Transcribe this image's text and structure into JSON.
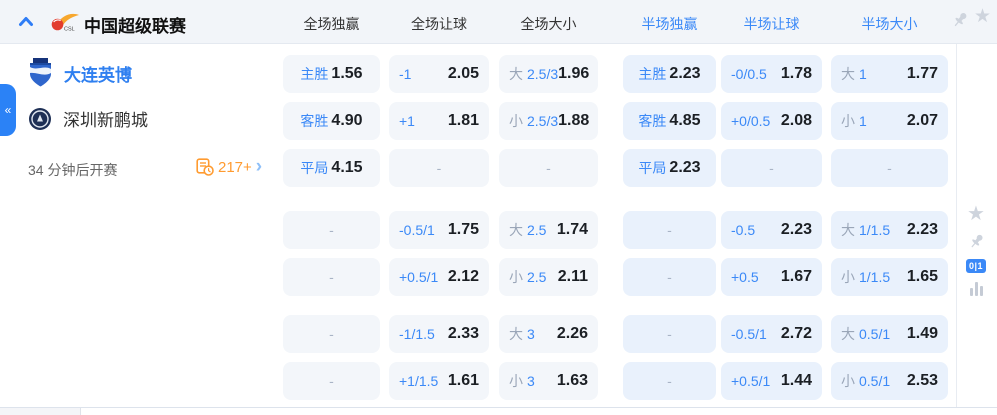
{
  "header": {
    "league_title": "中国超级联赛",
    "columns": [
      {
        "label": "全场独赢",
        "scope": "full"
      },
      {
        "label": "全场让球",
        "scope": "full"
      },
      {
        "label": "全场大小",
        "scope": "full"
      },
      {
        "label": "半场独赢",
        "scope": "half"
      },
      {
        "label": "半场让球",
        "scope": "half"
      },
      {
        "label": "半场大小",
        "scope": "half"
      }
    ]
  },
  "match": {
    "home_team": "大连英博",
    "away_team": "深圳新鹏城",
    "kickoff_note": "34 分钟后开赛",
    "markets_count": "217+",
    "markets_chevron": "›",
    "collapse_tab_glyph": "«"
  },
  "odds": {
    "rows": [
      {
        "cells": [
          {
            "label": "主胜",
            "value": "1.56"
          },
          {
            "label": "-1",
            "value": "2.05"
          },
          {
            "prefix": "大",
            "label": "2.5/3",
            "value": "1.96"
          },
          {
            "label": "主胜",
            "value": "2.23"
          },
          {
            "label": "-0/0.5",
            "value": "1.78"
          },
          {
            "prefix": "大",
            "label": "1",
            "value": "1.77"
          }
        ]
      },
      {
        "cells": [
          {
            "label": "客胜",
            "value": "4.90"
          },
          {
            "label": "+1",
            "value": "1.81"
          },
          {
            "prefix": "小",
            "label": "2.5/3",
            "value": "1.88"
          },
          {
            "label": "客胜",
            "value": "4.85"
          },
          {
            "label": "+0/0.5",
            "value": "2.08"
          },
          {
            "prefix": "小",
            "label": "1",
            "value": "2.07"
          }
        ]
      },
      {
        "cells": [
          {
            "label": "平局",
            "value": "4.15"
          },
          {
            "dash": "-"
          },
          {
            "dash": "-"
          },
          {
            "label": "平局",
            "value": "2.23"
          },
          {
            "dash": "-"
          },
          {
            "dash": "-"
          }
        ]
      },
      {
        "cells": [
          {
            "dash": "-"
          },
          {
            "label": "-0.5/1",
            "value": "1.75"
          },
          {
            "prefix": "大",
            "label": "2.5",
            "value": "1.74"
          },
          {
            "dash": "-"
          },
          {
            "label": "-0.5",
            "value": "2.23"
          },
          {
            "prefix": "大",
            "label": "1/1.5",
            "value": "2.23"
          }
        ]
      },
      {
        "cells": [
          {
            "dash": "-"
          },
          {
            "label": "+0.5/1",
            "value": "2.12"
          },
          {
            "prefix": "小",
            "label": "2.5",
            "value": "2.11"
          },
          {
            "dash": "-"
          },
          {
            "label": "+0.5",
            "value": "1.67"
          },
          {
            "prefix": "小",
            "label": "1/1.5",
            "value": "1.65"
          }
        ]
      },
      {
        "cells": [
          {
            "dash": "-"
          },
          {
            "label": "-1/1.5",
            "value": "2.33"
          },
          {
            "prefix": "大",
            "label": "3",
            "value": "2.26"
          },
          {
            "dash": "-"
          },
          {
            "label": "-0.5/1",
            "value": "2.72"
          },
          {
            "prefix": "大",
            "label": "0.5/1",
            "value": "1.49"
          }
        ]
      },
      {
        "cells": [
          {
            "dash": "-"
          },
          {
            "label": "+1/1.5",
            "value": "1.61"
          },
          {
            "prefix": "小",
            "label": "3",
            "value": "1.63"
          },
          {
            "dash": "-"
          },
          {
            "label": "+0.5/1",
            "value": "1.44"
          },
          {
            "prefix": "小",
            "label": "0.5/1",
            "value": "2.53"
          }
        ]
      }
    ]
  },
  "side_rail": {
    "score_badge": "0|1",
    "icons": [
      "star-icon",
      "pin-icon",
      "score-toggle-badge",
      "bar-chart-icon"
    ]
  },
  "icons": {
    "collapse": "chevron-up-icon",
    "league": "csl-logo-icon",
    "header_right": [
      "pin-icon",
      "star-icon"
    ],
    "star_glyph": "★"
  },
  "colors": {
    "accent_blue": "#3b89f7",
    "team_home_blue": "#2e7ff0",
    "orange": "#ff9b30",
    "full_cell_bg": "#f3f6fa",
    "half_cell_bg": "#e9f1fc",
    "value_dark": "#1b1f24",
    "prefix_gray": "#9aa6b8"
  }
}
